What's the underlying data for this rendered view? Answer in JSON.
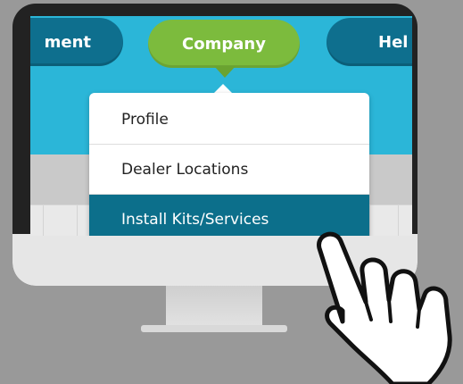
{
  "nav": {
    "prev_partial_label": "ment",
    "active_label": "Company",
    "next_partial_label": "Hel"
  },
  "dropdown": {
    "items": [
      {
        "label": "Profile"
      },
      {
        "label": "Dealer Locations"
      },
      {
        "label": "Install Kits/Services",
        "highlighted": true
      }
    ]
  },
  "colors": {
    "header_bg": "#2bb6d8",
    "nav_pill": "#0e6f8e",
    "nav_active": "#7cbb3d",
    "highlight": "#0c6f8b"
  },
  "icons": {
    "pointer": "pointing-hand-icon"
  }
}
